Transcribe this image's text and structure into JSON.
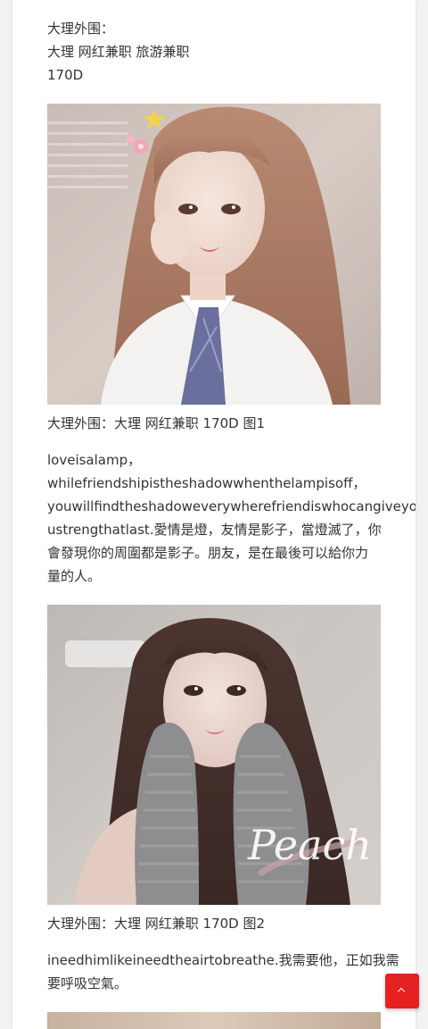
{
  "article": {
    "intro": {
      "line1": "大理外围：",
      "line2": "大理 网红兼职 旅游兼职",
      "line3": "170D"
    },
    "photos": [
      {
        "caption": "大理外围：大理 网红兼职 170D 图1"
      },
      {
        "caption": "大理外围：大理 网红兼职 170D 图2",
        "watermark": "Peach"
      }
    ],
    "paragraph1": {
      "lines": [
        "loveisalamp，",
        "whilefriendshipistheshadowwhenthelampisoff，",
        "youwillfindtheshadoweverywherefriendiswhocangiveyo",
        "ustrengthatlast.愛情是燈，友情是影子，當燈滅了，你",
        "會發現你的周圍都是影子。朋友，是在最後可以給你力",
        "量的人。"
      ]
    },
    "paragraph2": {
      "lines": [
        "ineedhimlikeineedtheairtobreathe.我需要他，正如我需",
        "要呼吸空氣。"
      ]
    }
  },
  "colors": {
    "accent": "#e52121",
    "text": "#333333",
    "page_background": "#f2f2f2"
  },
  "back_to_top": {
    "icon": "chevron-up-icon"
  }
}
